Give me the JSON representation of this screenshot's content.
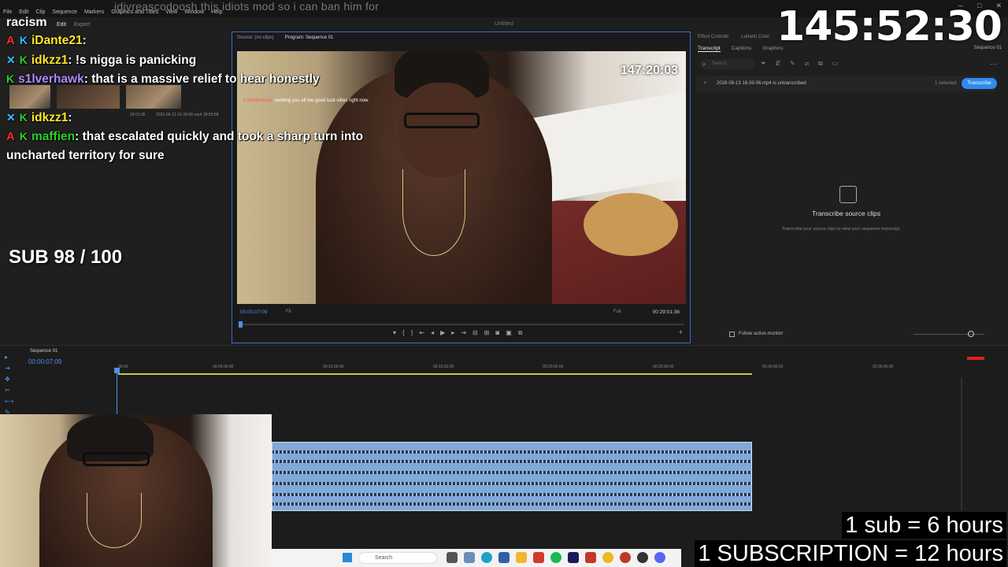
{
  "stream": {
    "title": "idjvreascodoosh this idiots mod so i can ban him for",
    "timer": "145:52:30",
    "chat_top": "racism",
    "sub_goal": "SUB 98 / 100",
    "sub_rate_1": "1 sub = 6 hours",
    "sub_rate_2": "1 SUBSCRIPTION = 12 hours"
  },
  "chat": [
    {
      "user": "iDante21",
      "sep": ":",
      "text": ""
    },
    {
      "user": "idkzz1",
      "sep": ":",
      "text": " !s nigga is panicking"
    },
    {
      "user": "s1lverhawk",
      "sep": ":",
      "text": " that is a massive relief to hear honestly"
    },
    {
      "user": "idkzz1",
      "sep": ":",
      "text": ""
    },
    {
      "user": "maffien",
      "sep": ":",
      "text": " that escalated quickly and took a sharp turn into"
    },
    {
      "user": "",
      "sep": "",
      "text": "uncharted territory for sure"
    }
  ],
  "premiere": {
    "menu": [
      "File",
      "Edit",
      "Clip",
      "Sequence",
      "Markers",
      "Graphics and Titles",
      "View",
      "Window",
      "Help"
    ],
    "window_title": "Untitled",
    "workspace_tabs": [
      "Edit",
      "Export"
    ],
    "monitor_tabs": [
      "Source: (no clips)",
      "Program: Sequence 01"
    ],
    "video_timer": "147:20:03",
    "video_msg_user": "s wlettlewood:",
    "video_msg_text": "sending you all the good luck vibes right now",
    "timecode_current": "00:00:07:09",
    "timecode_total": "00:29:01:36",
    "fit_label": "Fit",
    "quality_label": "Full",
    "thumb_captions": [
      "29:01:36",
      "2026-08-13 16-39-06.mp4",
      "28:59:58"
    ],
    "right_panel": {
      "top_tabs": [
        "Effect Controls",
        "Lumetri Color",
        "Essential"
      ],
      "tabs": [
        "Transcript",
        "Captions",
        "Graphics"
      ],
      "sequence": "Sequence 01",
      "search_placeholder": "Search",
      "file": "2026-08-13 16-39-06.mp4 is untranscribed",
      "selected": "1 selected",
      "transcribe_button": "Transcribe",
      "empty_title": "Transcribe source clips",
      "empty_sub": "Transcribe your source clips to view your sequence transcript.",
      "follow_label": "Follow active monitor"
    },
    "timeline": {
      "sequence": "Sequence 01",
      "timecode": "00:00:07:09",
      "ticks": [
        "00:00",
        "00:05:00:00",
        "00:10:00:00",
        "00:15:00:00",
        "00:20:00:00",
        "00:25:00:00",
        "00:30:00:00",
        "00:35:00:00"
      ]
    }
  },
  "taskbar": {
    "search_placeholder": "Search"
  }
}
